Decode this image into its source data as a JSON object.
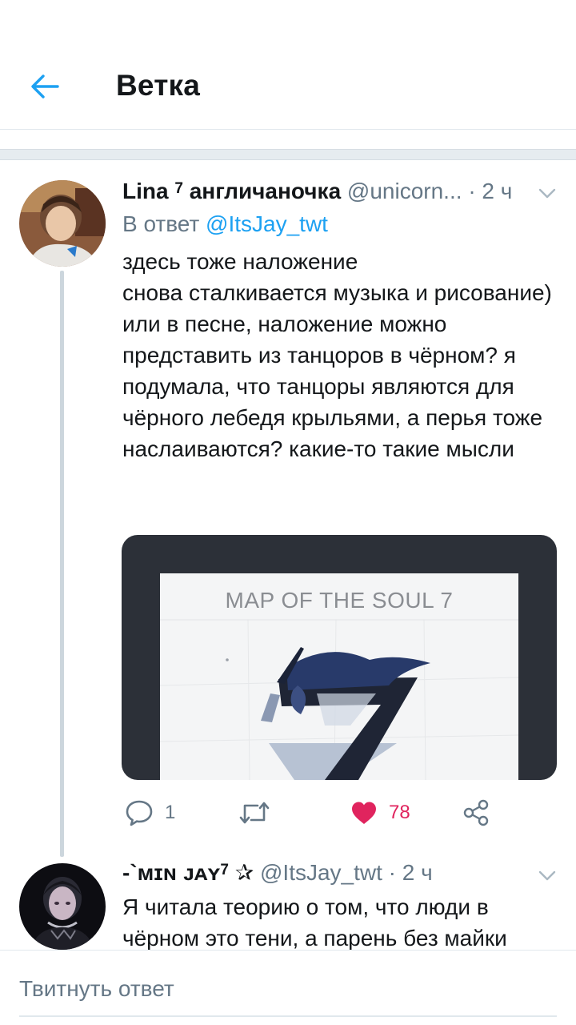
{
  "header": {
    "title": "Ветка",
    "back_icon": "arrow-left-icon"
  },
  "tweets": [
    {
      "name": "Lina",
      "name_sup": "7",
      "name_rest": "англичаночка",
      "handle": "@unicorn...",
      "dot": "·",
      "time": "2 ч",
      "reply_prefix": "В ответ",
      "reply_mention": "@ItsJay_twt",
      "text": "здесь тоже наложение\nснова сталкивается музыка и рисование)\nили в песне, наложение можно представить из танцоров в чёрном? я подумала, что танцоры являются для чёрного лебедя крыльями, а перья тоже наслаиваются? какие-то такие мысли",
      "media": {
        "album_title": "MAP OF THE SOUL 7"
      },
      "actions": {
        "reply_count": "1",
        "retweet_count": "",
        "like_count": "78"
      }
    },
    {
      "name": "-`ᴍɪɴ ᴊᴀʏ",
      "name_sup": "7",
      "name_rest": "✰",
      "handle": "@ItsJay_twt",
      "dot": "·",
      "time": "2 ч",
      "text": "Я читала теорию о том, что люди в чёрном это тени, а парень без майки"
    }
  ],
  "compose": {
    "placeholder": "Твитнуть ответ"
  },
  "colors": {
    "accent": "#1da1f2",
    "like": "#e0245e",
    "muted": "#657786",
    "text": "#14171a",
    "divider": "#e1e8ed"
  }
}
